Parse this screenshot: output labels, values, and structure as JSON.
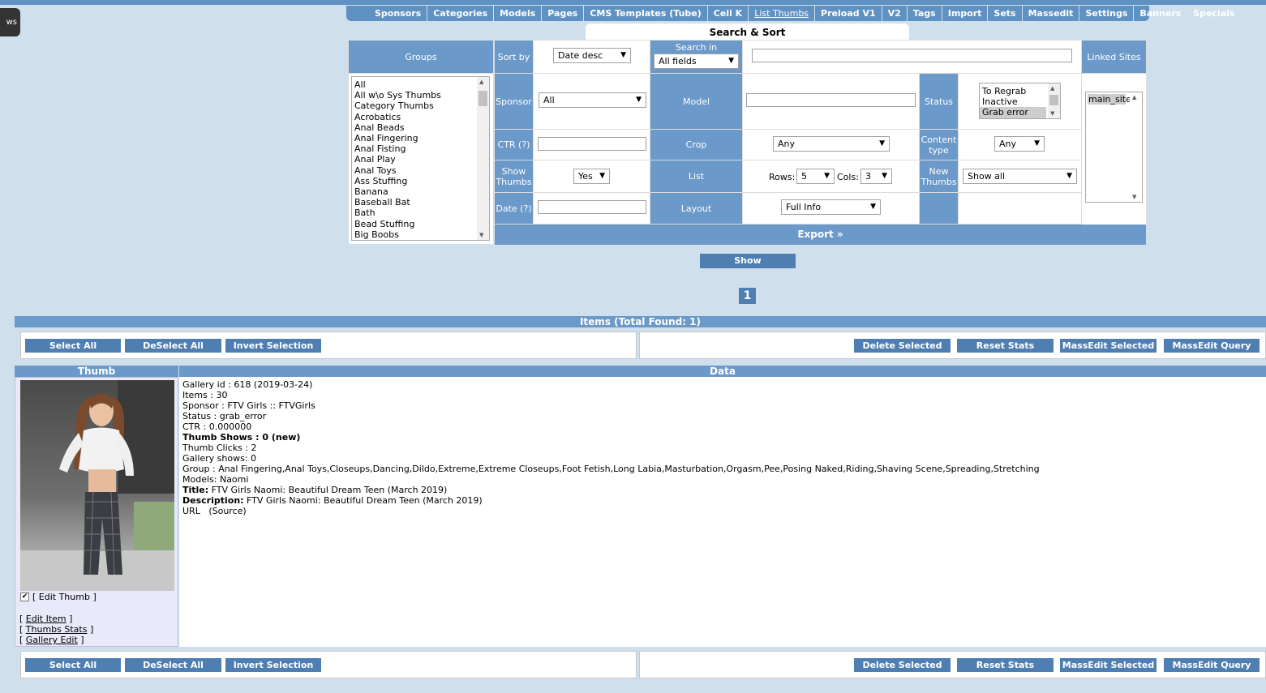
{
  "sidetab": {
    "label": "ws"
  },
  "nav": {
    "items": [
      {
        "label": "Sponsors"
      },
      {
        "label": "Categories"
      },
      {
        "label": "Models"
      },
      {
        "label": "Pages"
      },
      {
        "label": "CMS Templates (Tube)"
      },
      {
        "label": "Cell K"
      },
      {
        "label": "List Thumbs",
        "active": true
      },
      {
        "label": "Preload V1"
      },
      {
        "label": "V2"
      },
      {
        "label": "Tags"
      },
      {
        "label": "Import"
      },
      {
        "label": "Sets"
      },
      {
        "label": "Massedit"
      },
      {
        "label": "Settings"
      },
      {
        "label": "Banners"
      },
      {
        "label": "Specials"
      }
    ]
  },
  "search": {
    "title": "Search & Sort",
    "groups_label": "Groups",
    "groups_options": [
      "All",
      "All w\\o Sys Thumbs",
      "Category Thumbs",
      "Acrobatics",
      "Anal Beads",
      "Anal Fingering",
      "Anal Fisting",
      "Anal Play",
      "Anal Toys",
      "Ass Stuffing",
      "Banana",
      "Baseball Bat",
      "Bath",
      "Bead Stuffing",
      "Big Boobs"
    ],
    "sortby_label": "Sort by",
    "sortby_value": "Date desc",
    "searchin_label": "Search in",
    "searchin_value": "All fields",
    "linked_sites_label": "Linked Sites",
    "linked_sites_options": [
      "main_site"
    ],
    "sponsor_label": "Sponsor",
    "sponsor_value": "All",
    "model_label": "Model",
    "status_label": "Status",
    "status_options": [
      "To Regrab",
      "Inactive",
      "Grab error"
    ],
    "ctr_label": "CTR (?)",
    "crop_label": "Crop",
    "crop_value": "Any",
    "content_type_label": "Content type",
    "content_type_value": "Any",
    "show_thumbs_label": "Show Thumbs",
    "show_thumbs_value": "Yes",
    "list_label": "List",
    "rows_label": "Rows:",
    "rows_value": "5",
    "cols_label": "Cols:",
    "cols_value": "3",
    "new_thumbs_label": "New Thumbs",
    "new_thumbs_value": "Show all",
    "date_label": "Date (?)",
    "layout_label": "Layout",
    "layout_value": "Full Info",
    "export_label": "Export »",
    "show_button": "Show"
  },
  "pagination": {
    "current": "1"
  },
  "items": {
    "header": "Items (Total Found: 1)",
    "select_all": "Select All",
    "deselect_all": "DeSelect All",
    "invert_selection": "Invert Selection",
    "delete_selected": "Delete Selected",
    "reset_stats": "Reset Stats",
    "massedit_selected": "MassEdit Selected",
    "massedit_query": "MassEdit Query",
    "thumb_col": "Thumb",
    "data_col": "Data"
  },
  "item": {
    "edit_thumb": "[ Edit Thumb ]",
    "edit_item": "Edit Item",
    "thumbs_stats": "Thumbs Stats",
    "gallery_edit": "Gallery Edit",
    "gallery_id": "Gallery id : 618 (2019-03-24)",
    "items_count": "Items : 30",
    "sponsor": "Sponsor : FTV Girls :: FTVGirls",
    "status": "Status : grab_error",
    "ctr": "CTR : 0.000000",
    "thumb_shows": "Thumb Shows : 0 (new)",
    "thumb_clicks": "Thumb Clicks : 2",
    "gallery_shows": "Gallery shows: 0",
    "group": "Group : Anal Fingering,Anal Toys,Closeups,Dancing,Dildo,Extreme,Extreme Closeups,Foot Fetish,Long Labia,Masturbation,Orgasm,Pee,Posing Naked,Riding,Shaving Scene,Spreading,Stretching",
    "models": "Models: Naomi",
    "title_label": "Title:",
    "title_value": "FTV Girls Naomi: Beautiful Dream Teen (March 2019)",
    "description_label": "Description:",
    "description_value": "FTV Girls Naomi: Beautiful Dream Teen (March 2019)",
    "url_label": "URL",
    "source_label": "(Source)"
  }
}
